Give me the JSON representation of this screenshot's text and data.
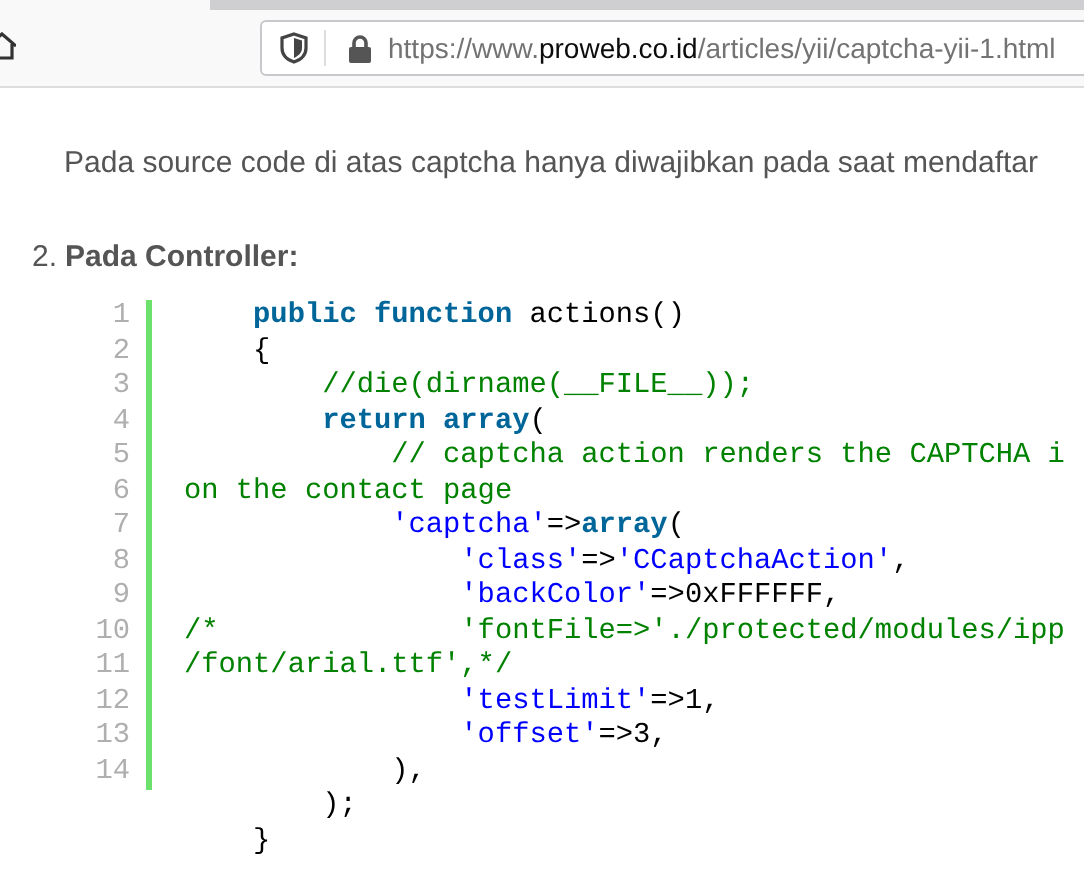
{
  "browser": {
    "url": {
      "scheme": "https://www.",
      "domain": "proweb.co.id",
      "path": "/articles/yii/captcha-yii-1.html"
    }
  },
  "article": {
    "paragraph": "Pada source code di atas captcha hanya diwajibkan pada saat mendaftar",
    "list_item": {
      "marker": "2.",
      "heading": "Pada Controller:"
    },
    "code": [
      {
        "number": "1",
        "tokens": [
          {
            "kind": "keyword",
            "text": "    public function"
          },
          {
            "kind": "plain",
            "text": " actions()"
          }
        ]
      },
      {
        "number": "2",
        "tokens": [
          {
            "kind": "plain",
            "text": "    {"
          }
        ]
      },
      {
        "number": "3",
        "tokens": [
          {
            "kind": "comment",
            "text": "        //die(dirname(__FILE__));"
          }
        ]
      },
      {
        "number": "4",
        "tokens": [
          {
            "kind": "keyword",
            "text": "        return array"
          },
          {
            "kind": "plain",
            "text": "("
          }
        ]
      },
      {
        "number": "5",
        "tokens": [
          {
            "kind": "comment",
            "text": "            // captcha action renders the CAPTCHA i"
          }
        ]
      },
      {
        "number": "6",
        "tokens": [
          {
            "kind": "comment",
            "text": "on the contact page"
          }
        ]
      },
      {
        "number": "7",
        "tokens": [
          {
            "kind": "string",
            "text": "            'captcha'"
          },
          {
            "kind": "plain",
            "text": "=>"
          },
          {
            "kind": "keyword",
            "text": "array"
          },
          {
            "kind": "plain",
            "text": "("
          }
        ]
      },
      {
        "number": "8",
        "tokens": [
          {
            "kind": "string",
            "text": "                'class'"
          },
          {
            "kind": "plain",
            "text": "=>"
          },
          {
            "kind": "string",
            "text": "'CCaptchaAction'"
          },
          {
            "kind": "plain",
            "text": ","
          }
        ]
      },
      {
        "number": "9",
        "tokens": [
          {
            "kind": "string",
            "text": "                'backColor'"
          },
          {
            "kind": "plain",
            "text": "=>0xFFFFFF,"
          }
        ]
      },
      {
        "number": "10",
        "tokens": [
          {
            "kind": "comment",
            "text": "/*              'fontFile=>'./protected/modules/ipp"
          }
        ]
      },
      {
        "number": "11",
        "tokens": [
          {
            "kind": "comment",
            "text": "/font/arial.ttf',*/"
          }
        ]
      },
      {
        "number": "12",
        "tokens": [
          {
            "kind": "string",
            "text": "                'testLimit'"
          },
          {
            "kind": "plain",
            "text": "=>1,"
          }
        ]
      },
      {
        "number": "13",
        "tokens": [
          {
            "kind": "string",
            "text": "                'offset'"
          },
          {
            "kind": "plain",
            "text": "=>3,"
          }
        ]
      },
      {
        "number": "14",
        "tokens": [
          {
            "kind": "plain",
            "text": "            ),"
          }
        ]
      }
    ],
    "code_overflow": [
      {
        "tokens": [
          {
            "kind": "plain",
            "text": "        );"
          }
        ]
      },
      {
        "tokens": [
          {
            "kind": "plain",
            "text": "    }"
          }
        ]
      }
    ]
  }
}
